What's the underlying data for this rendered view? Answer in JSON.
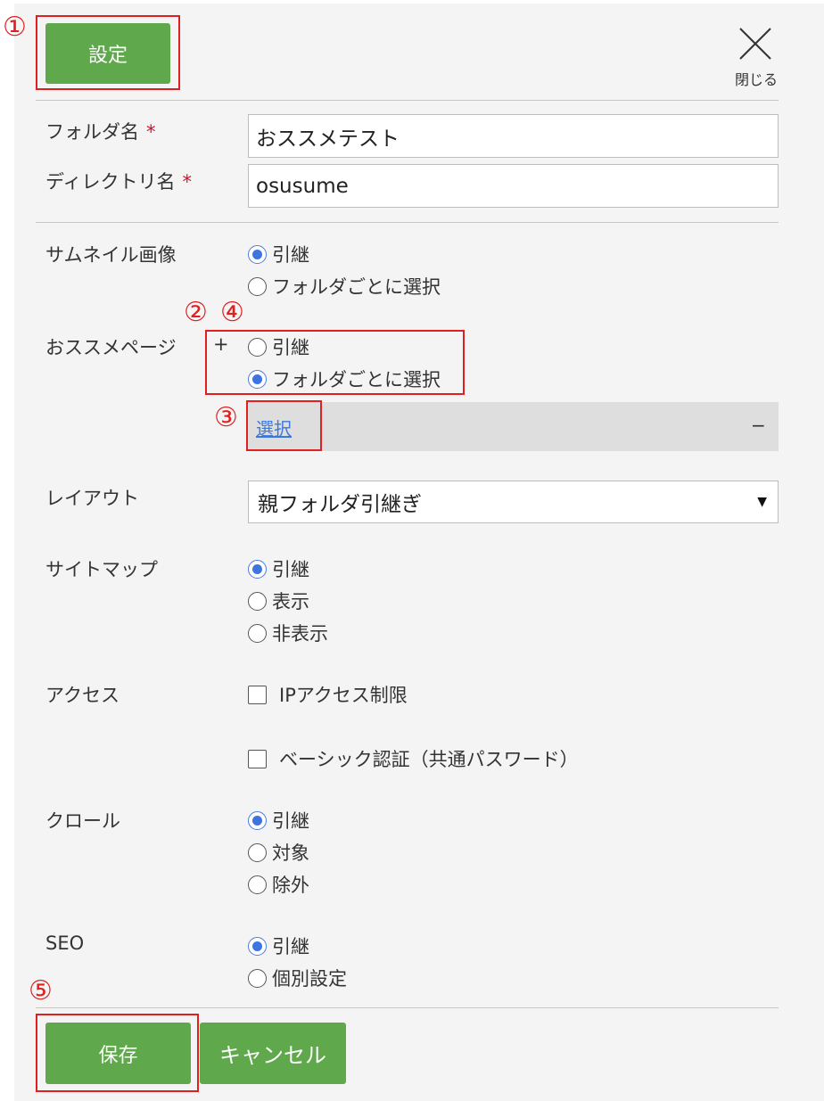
{
  "header": {
    "settings_label": "設定",
    "close_label": "閉じる"
  },
  "annotations": {
    "m1": "①",
    "m2": "②",
    "m3": "③",
    "m4": "④",
    "m5": "⑤"
  },
  "form": {
    "folder_name": {
      "label": "フォルダ名",
      "required_mark": "*",
      "value": "おススメテスト"
    },
    "directory_name": {
      "label": "ディレクトリ名",
      "required_mark": "*",
      "value": "osusume"
    },
    "thumbnail": {
      "label": "サムネイル画像",
      "options": [
        "引継",
        "フォルダごとに選択"
      ],
      "selected": 0
    },
    "recommend": {
      "label": "おススメページ",
      "plus": "+",
      "options": [
        "引継",
        "フォルダごとに選択"
      ],
      "selected": 1,
      "select_link": "選択",
      "collapse": "−"
    },
    "layout": {
      "label": "レイアウト",
      "value": "親フォルダ引継ぎ",
      "arrow": "▼"
    },
    "sitemap": {
      "label": "サイトマップ",
      "options": [
        "引継",
        "表示",
        "非表示"
      ],
      "selected": 0
    },
    "access": {
      "label": "アクセス",
      "options": [
        "IPアクセス制限",
        "ベーシック認証（共通パスワード）"
      ]
    },
    "crawl": {
      "label": "クロール",
      "options": [
        "引継",
        "対象",
        "除外"
      ],
      "selected": 0
    },
    "seo": {
      "label": "SEO",
      "options": [
        "引継",
        "個別設定"
      ],
      "selected": 0
    }
  },
  "footer": {
    "save_label": "保存",
    "cancel_label": "キャンセル"
  },
  "colors": {
    "button_green": "#5fa84c",
    "annotation_red": "#e02020",
    "radio_blue": "#3d74e0",
    "link_blue": "#3d78d8"
  }
}
